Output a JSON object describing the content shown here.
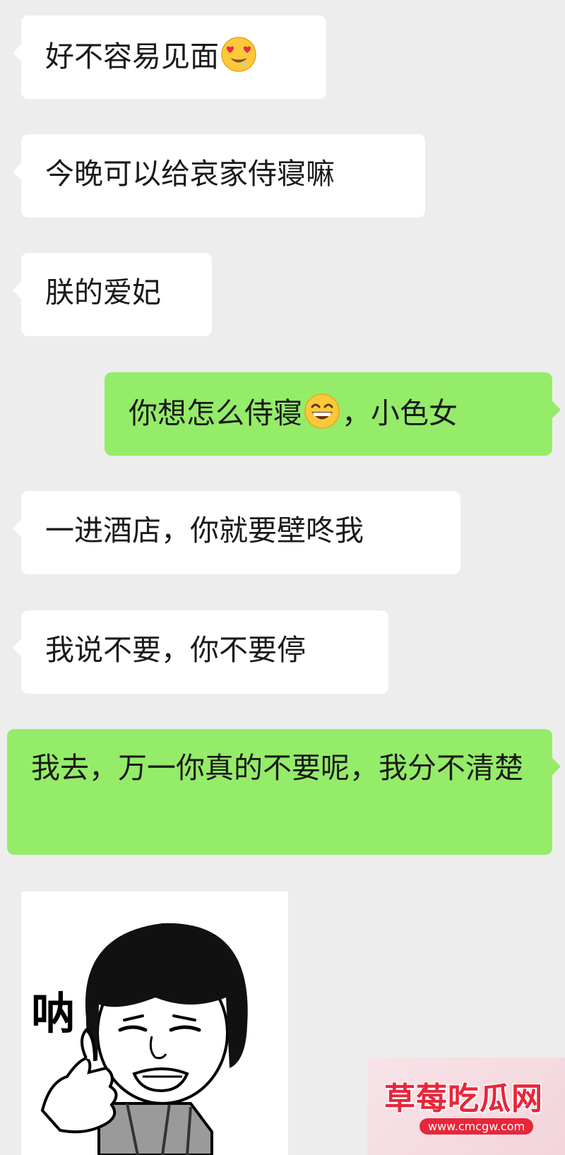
{
  "messages": [
    {
      "side": "left",
      "text": "好不容易见面",
      "emoji": "heart-eyes-emoji"
    },
    {
      "side": "left",
      "text": "今晚可以给哀家侍寝嘛"
    },
    {
      "side": "left",
      "text": "朕的爱妃"
    },
    {
      "side": "right",
      "text_before": "你想怎么侍寝",
      "emoji": "grinning-emoji",
      "text_after": "，小色女"
    },
    {
      "side": "left",
      "text": "一进酒店，你就要壁咚我"
    },
    {
      "side": "left",
      "text": "我说不要，你不要停"
    },
    {
      "side": "right",
      "text": "我去，万一你真的不要呢，我分不清楚"
    }
  ],
  "sticker": {
    "text": "呐",
    "description": "mushroom-head-meme"
  },
  "watermark": {
    "title": "草莓吃瓜网",
    "url": "www.cmcgw.com"
  },
  "colors": {
    "background": "#ededed",
    "incoming_bubble": "#ffffff",
    "outgoing_bubble": "#95ec69",
    "watermark_red": "#e8263a"
  }
}
